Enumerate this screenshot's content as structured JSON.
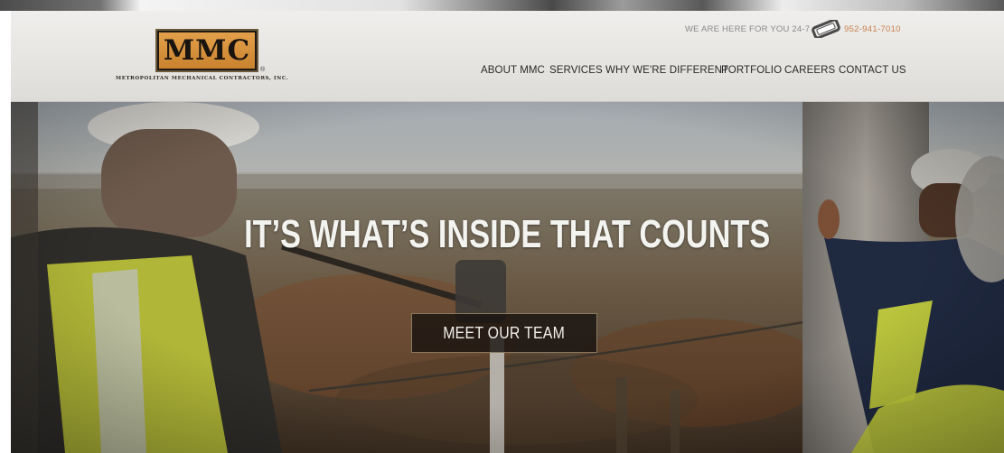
{
  "brand": {
    "logo_text": "MMC",
    "registered_mark": "®",
    "company_name": "Metropolitan Mechanical Contractors, Inc."
  },
  "contact": {
    "tagline": "WE ARE HERE FOR YOU 24-7",
    "phone": "952-941-7010",
    "phone_icon": "phone-icon"
  },
  "nav": {
    "items": [
      {
        "label": "ABOUT MMC"
      },
      {
        "label": "SERVICES"
      },
      {
        "label": "WHY WE'RE DIFFERENT"
      },
      {
        "label": "PORTFOLIO"
      },
      {
        "label": "CAREERS"
      },
      {
        "label": "CONTACT US"
      }
    ]
  },
  "hero": {
    "headline": "IT’S WHAT’S INSIDE THAT COUNTS",
    "cta_label": "MEET OUR TEAM"
  },
  "colors": {
    "accent_orange": "#c8804a",
    "logo_gold": "#e3a04b",
    "header_bg": "#e8e7e4",
    "cta_bg": "#1a1410"
  }
}
